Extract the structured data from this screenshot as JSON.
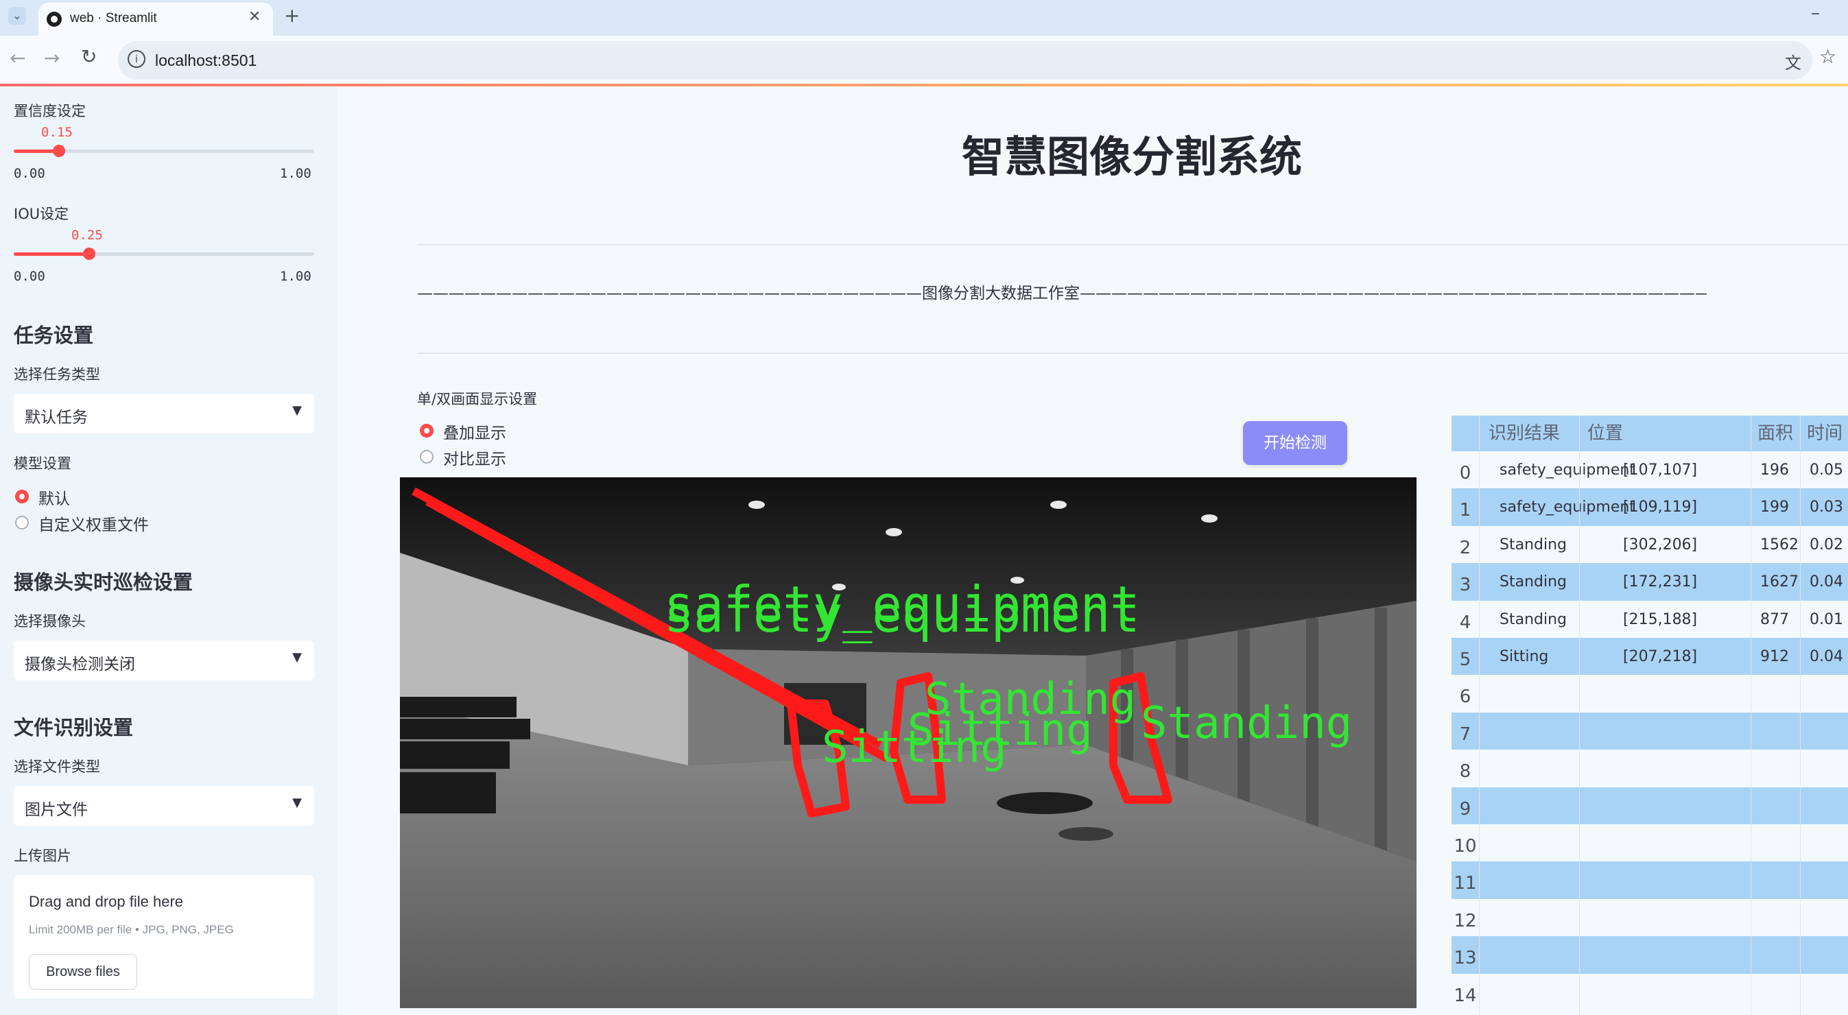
{
  "browser": {
    "tab_title": "web · Streamlit",
    "url": "localhost:8501"
  },
  "sidebar": {
    "confidence": {
      "label": "置信度设定",
      "value": "0.15",
      "min": "0.00",
      "max": "1.00",
      "fraction": 0.15
    },
    "iou": {
      "label": "IOU设定",
      "value": "0.25",
      "min": "0.00",
      "max": "1.00",
      "fraction": 0.25
    },
    "task_header": "任务设置",
    "task_type_label": "选择任务类型",
    "task_type_value": "默认任务",
    "model_label": "模型设置",
    "model_options": [
      "默认",
      "自定义权重文件"
    ],
    "model_selected": 0,
    "camera_header": "摄像头实时巡检设置",
    "camera_label": "选择摄像头",
    "camera_value": "摄像头检测关闭",
    "file_header": "文件识别设置",
    "file_type_label": "选择文件类型",
    "file_type_value": "图片文件",
    "upload_label": "上传图片",
    "upload_drop": "Drag and drop file here",
    "upload_limit": "Limit 200MB per file • JPG, PNG, JPEG",
    "browse_label": "Browse files"
  },
  "main": {
    "title": "智慧图像分割系统",
    "studio_line": "————————————————————————————————图像分割大数据工作室————————————————————————————————————————",
    "display_label": "单/双画面显示设置",
    "display_options": [
      "叠加显示",
      "对比显示"
    ],
    "display_selected": 0,
    "start_button": "开始检测",
    "overlay_labels": {
      "safety": "safety_equipment",
      "standing": "Standing",
      "sitting": "Sitting"
    }
  },
  "table": {
    "columns": [
      "识别结果",
      "位置",
      "面积",
      "时间"
    ],
    "rows": [
      {
        "index": "0",
        "result": "safety_equipment",
        "position": "[107,107]",
        "area": "196",
        "time": "0.05"
      },
      {
        "index": "1",
        "result": "safety_equipment",
        "position": "[109,119]",
        "area": "199",
        "time": "0.03"
      },
      {
        "index": "2",
        "result": "Standing",
        "position": "[302,206]",
        "area": "1562",
        "time": "0.02"
      },
      {
        "index": "3",
        "result": "Standing",
        "position": "[172,231]",
        "area": "1627",
        "time": "0.04"
      },
      {
        "index": "4",
        "result": "Standing",
        "position": "[215,188]",
        "area": "877",
        "time": "0.01"
      },
      {
        "index": "5",
        "result": "Sitting",
        "position": "[207,218]",
        "area": "912",
        "time": "0.04"
      }
    ],
    "empty_indices": [
      "6",
      "7",
      "8",
      "9",
      "10",
      "11",
      "12",
      "13",
      "14"
    ]
  },
  "colors": {
    "accent": "#ff4b4b",
    "button": "#8b8cf7",
    "table_stripe": "#a9d3f5",
    "mask": "#ff1a1a",
    "label_green": "#33e633"
  }
}
